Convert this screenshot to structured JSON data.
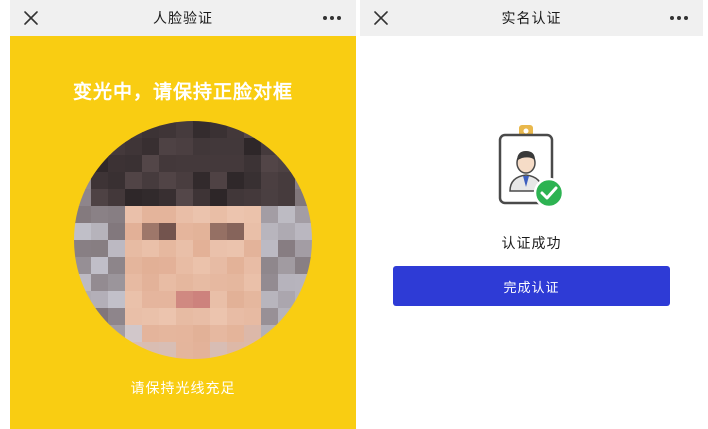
{
  "face_screen": {
    "title": "人脸验证",
    "close_icon": "close-icon",
    "more_icon": "more-icon",
    "hint": "变光中，请保持正脸对框",
    "light_hint": "请保持光线充足",
    "background_color": "#F9CD12",
    "face_preview": "pixelated-face"
  },
  "result_screen": {
    "title": "实名认证",
    "close_icon": "close-icon",
    "more_icon": "more-icon",
    "status_icon": "id-badge-verified-icon",
    "status_text": "认证成功",
    "complete_button": "完成认证",
    "button_color": "#2E3BD6",
    "check_color": "#2DB352"
  }
}
